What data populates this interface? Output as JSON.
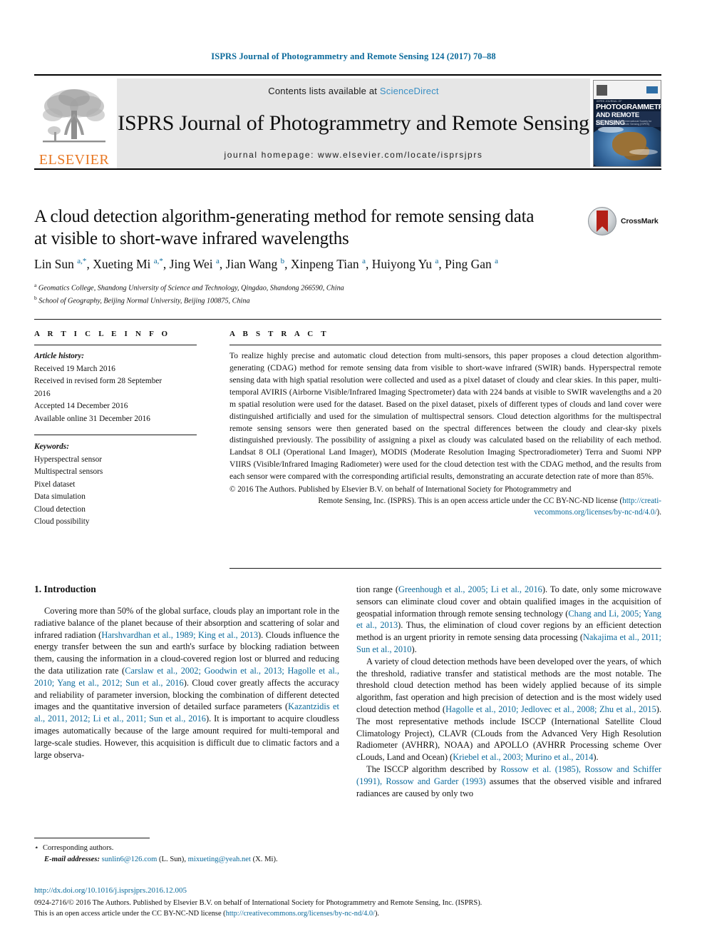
{
  "running_head": "ISPRS Journal of Photogrammetry and Remote Sensing 124 (2017) 70–88",
  "banner": {
    "publisher_logo_word": "ELSEVIER",
    "contents_prefix": "Contents lists available at ",
    "contents_link": "ScienceDirect",
    "journal_title": "ISPRS Journal of Photogrammetry and Remote Sensing",
    "homepage_line": "journal homepage: www.elsevier.com/locate/isprsjprs",
    "cover": {
      "line1": "PHOTOGRAMMETRY",
      "line2": "AND REMOTE SENSING",
      "kicker": "ISPRS JOURNAL OF",
      "subline": "Official Publication of the International Society for Photogrammetry and Remote Sensing (ISPRS)"
    }
  },
  "article": {
    "title_line1": "A cloud detection algorithm-generating method for remote sensing data",
    "title_line2": "at visible to short-wave infrared wavelengths",
    "crossmark_label": "CrossMark",
    "authors_html": "Lin Sun <sup>a,*</sup>, Xueting Mi <sup>a,*</sup>, Jing Wei <sup>a</sup>, Jian Wang <sup>b</sup>, Xinpeng Tian <sup>a</sup>, Huiyong Yu <sup>a</sup>, Ping Gan <sup>a</sup>",
    "affiliation_a": "Geomatics College, Shandong University of Science and Technology, Qingdao, Shandong 266590, China",
    "affiliation_b": "School of Geography, Beijing Normal University, Beijing 100875, China"
  },
  "article_info": {
    "heading": "A R T I C L E   I N F O",
    "history_label": "Article history:",
    "history": [
      "Received 19 March 2016",
      "Received in revised form 28 September",
      "2016",
      "Accepted 14 December 2016",
      "Available online 31 December 2016"
    ],
    "keywords_label": "Keywords:",
    "keywords": [
      "Hyperspectral sensor",
      "Multispectral sensors",
      "Pixel dataset",
      "Data simulation",
      "Cloud detection",
      "Cloud possibility"
    ]
  },
  "abstract": {
    "heading": "A B S T R A C T",
    "body": "To realize highly precise and automatic cloud detection from multi-sensors, this paper proposes a cloud detection algorithm-generating (CDAG) method for remote sensing data from visible to short-wave infrared (SWIR) bands. Hyperspectral remote sensing data with high spatial resolution were collected and used as a pixel dataset of cloudy and clear skies. In this paper, multi-temporal AVIRIS (Airborne Visible/Infrared Imaging Spectrometer) data with 224 bands at visible to SWIR wavelengths and a 20 m spatial resolution were used for the dataset. Based on the pixel dataset, pixels of different types of clouds and land cover were distinguished artificially and used for the simulation of multispectral sensors. Cloud detection algorithms for the multispectral remote sensing sensors were then generated based on the spectral differences between the cloudy and clear-sky pixels distinguished previously. The possibility of assigning a pixel as cloudy was calculated based on the reliability of each method. Landsat 8 OLI (Operational Land Imager), MODIS (Moderate Resolution Imaging Spectroradiometer) Terra and Suomi NPP VIIRS (Visible/Infrared Imaging Radiometer) were used for the cloud detection test with the CDAG method, and the results from each sensor were compared with the corresponding artificial results, demonstrating an accurate detection rate of more than 85%.",
    "copyright_line1": "© 2016 The Authors. Published by Elsevier B.V. on behalf of International Society for Photogrammetry and",
    "copyright_line2_pre": "Remote Sensing, Inc. (ISPRS). This is an open access article under the CC BY-NC-ND license (",
    "copyright_link1": "http://creati-",
    "copyright_link2": "vecommons.org/licenses/by-nc-nd/4.0/",
    "copyright_tail": ")."
  },
  "introduction": {
    "heading": "1. Introduction",
    "left_paragraphs": [
      {
        "segments": [
          {
            "t": "Covering more than 50% of the global surface, clouds play an important role in the radiative balance of the planet because of their absorption and scattering of solar and infrared radiation (",
            "link": false
          },
          {
            "t": "Harshvardhan et al., 1989; King et al., 2013",
            "link": true
          },
          {
            "t": "). Clouds influence the energy transfer between the sun and earth's surface by blocking radiation between them, causing the information in a cloud-covered region lost or blurred and reducing the data utilization rate (",
            "link": false
          },
          {
            "t": "Carslaw et al., 2002; Goodwin et al., 2013; Hagolle et al., 2010; Yang et al., 2012; Sun et al., 2016",
            "link": true
          },
          {
            "t": "). Cloud cover greatly affects the accuracy and reliability of parameter inversion, blocking the combination of different detected images and the quantitative inversion of detailed surface parameters (",
            "link": false
          },
          {
            "t": "Kazantzidis et al., 2011, 2012; Li et al., 2011; Sun et al., 2016",
            "link": true
          },
          {
            "t": "). It is important to acquire cloudless images automatically because of the large amount required for multi-temporal and large-scale studies. However, this acquisition is difficult due to climatic factors and a large observa-",
            "link": false
          }
        ]
      }
    ],
    "right_paragraphs": [
      {
        "indent": false,
        "segments": [
          {
            "t": "tion range (",
            "link": false
          },
          {
            "t": "Greenhough et al., 2005; Li et al., 2016",
            "link": true
          },
          {
            "t": "). To date, only some microwave sensors can eliminate cloud cover and obtain qualified images in the acquisition of geospatial information through remote sensing technology (",
            "link": false
          },
          {
            "t": "Chang and Li, 2005; Yang et al., 2013",
            "link": true
          },
          {
            "t": "). Thus, the elimination of cloud cover regions by an efficient detection method is an urgent priority in remote sensing data processing (",
            "link": false
          },
          {
            "t": "Nakajima et al., 2011; Sun et al., 2010",
            "link": true
          },
          {
            "t": ").",
            "link": false
          }
        ]
      },
      {
        "indent": true,
        "segments": [
          {
            "t": "A variety of cloud detection methods have been developed over the years, of which the threshold, radiative transfer and statistical methods are the most notable. The threshold cloud detection method has been widely applied because of its simple algorithm, fast operation and high precision of detection and is the most widely used cloud detection method (",
            "link": false
          },
          {
            "t": "Hagolle et al., 2010; Jedlovec et al., 2008; Zhu et al., 2015",
            "link": true
          },
          {
            "t": "). The most representative methods include ISCCP (International Satellite Cloud Climatology Project), CLAVR (CLouds from the Advanced Very High Resolution Radiometer (AVHRR), NOAA) and APOLLO (AVHRR Processing scheme Over cLouds, Land and Ocean) (",
            "link": false
          },
          {
            "t": "Kriebel et al., 2003; Murino et al., 2014",
            "link": true
          },
          {
            "t": ").",
            "link": false
          }
        ]
      },
      {
        "indent": true,
        "segments": [
          {
            "t": "The ISCCP algorithm described by ",
            "link": false
          },
          {
            "t": "Rossow et al. (1985), Rossow and Schiffer (1991), Rossow and Garder (1993)",
            "link": true
          },
          {
            "t": " assumes that the observed visible and infrared radiances are caused by only two",
            "link": false
          }
        ]
      }
    ]
  },
  "footnotes": {
    "corresponding": "Corresponding authors.",
    "email_label": "E-mail addresses:",
    "email1": "sunlin6@126.com",
    "email1_who": " (L. Sun), ",
    "email2": "mixueting@yeah.net",
    "email2_who": " (X. Mi)."
  },
  "footer": {
    "doi": "http://dx.doi.org/10.1016/j.isprsjprs.2016.12.005",
    "issn_line": "0924-2716/© 2016 The Authors. Published by Elsevier B.V. on behalf of International Society for Photogrammetry and Remote Sensing, Inc. (ISPRS).",
    "license_pre": "This is an open access article under the CC BY-NC-ND license (",
    "license_link": "http://creativecommons.org/licenses/by-nc-nd/4.0/",
    "license_tail": ")."
  },
  "colors": {
    "link_blue": "#0b6a9b",
    "elsevier_orange": "#E87722",
    "banner_gray": "#e6e6e6",
    "sciencedirect_blue": "#3a8fc4"
  }
}
